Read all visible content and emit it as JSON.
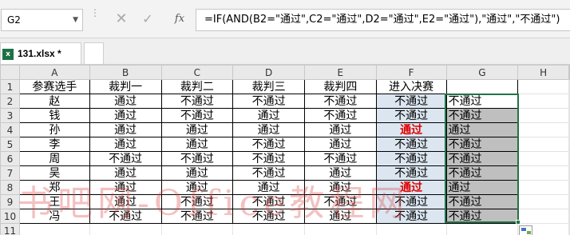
{
  "name_box": {
    "value": "G2"
  },
  "formula_bar": {
    "formula": "=IF(AND(B2=\"通过\",C2=\"通过\",D2=\"通过\",E2=\"通过\"),\"通过\",\"不通过\")",
    "cancel_icon": "close-icon",
    "enter_icon": "check-icon",
    "fx_label": "fx"
  },
  "tabs": {
    "file_name": "131.xlsx *",
    "file_icon": "excel-file-icon"
  },
  "columns": [
    "A",
    "B",
    "C",
    "D",
    "E",
    "F",
    "G",
    "H"
  ],
  "header_row": [
    "参赛选手",
    "裁判一",
    "裁判二",
    "裁判三",
    "裁判四",
    "进入决赛",
    ""
  ],
  "rows": [
    [
      "赵",
      "通过",
      "不通过",
      "不通过",
      "不通过",
      "不通过",
      "不通过"
    ],
    [
      "钱",
      "通过",
      "不通过",
      "通过",
      "不通过",
      "不通过",
      "不通过"
    ],
    [
      "孙",
      "通过",
      "通过",
      "通过",
      "通过",
      "通过",
      "通过"
    ],
    [
      "李",
      "通过",
      "通过",
      "不通过",
      "通过",
      "不通过",
      "不通过"
    ],
    [
      "周",
      "不通过",
      "不通过",
      "不通过",
      "不通过",
      "不通过",
      "不通过"
    ],
    [
      "吴",
      "通过",
      "通过",
      "不通过",
      "通过",
      "不通过",
      "不通过"
    ],
    [
      "郑",
      "通过",
      "通过",
      "通过",
      "通过",
      "通过",
      "通过"
    ],
    [
      "王",
      "通过",
      "不通过",
      "不通过",
      "不通过",
      "不通过",
      "不通过"
    ],
    [
      "冯",
      "不通过",
      "不通过",
      "不通过",
      "通过",
      "不通过",
      "不通过"
    ]
  ],
  "row_numbers": [
    "1",
    "2",
    "3",
    "4",
    "5",
    "6",
    "7",
    "8",
    "9",
    "10",
    "11"
  ],
  "watermark": "书吧网-Office教程网",
  "colors": {
    "highlight_blue": "#dce6f1",
    "formula_fill": "#bfbfbf",
    "pass_red": "#e00000",
    "selection_green": "#217346"
  }
}
